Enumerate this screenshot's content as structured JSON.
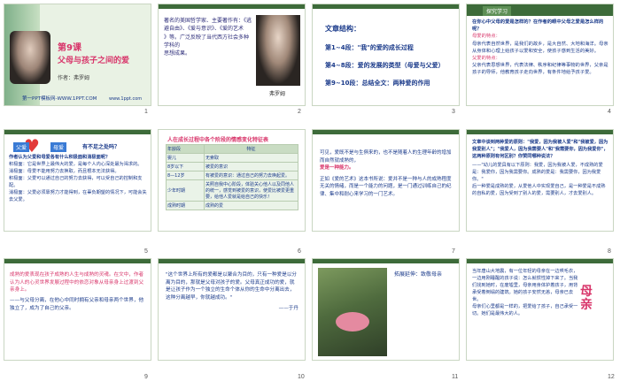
{
  "thumbnails": [
    {
      "num": "1",
      "title": "第9课",
      "subtitle": "父母与孩子之间的爱",
      "author": "作者：弗罗姆",
      "link": "第一PPT模板网-WWW.1PPT.COM",
      "url": "www.1ppt.com"
    },
    {
      "num": "2",
      "lines": [
        "著名的美国哲学家、主要著作有：《逃",
        "避自由》、《爱与意识》、《爱的艺术",
        "》等。广泛反映了当代西方社会多种学科的",
        "思想成果。"
      ],
      "caption": "弗罗姆"
    },
    {
      "num": "3",
      "heading": "文章结构：",
      "items": [
        "第1~4段：\"我\"的爱的成长过程",
        "第4~8段：爱的发展的类型（母爱与父爱）",
        "第9~10段：总结全文：两种爱的作用"
      ]
    },
    {
      "num": "4",
      "header": "探究学习",
      "lines": [
        "在你心中父母的爱是怎样的？在作者的眼中父母之爱是怎么样的呢？",
        "母爱的特点：",
        "母亲代表自然世界，是我们的故乡，是大自然、大地和海洋。母亲从身体和心理上给孩子以爱和安全，使孩子感到生活的美好。",
        "父爱的特点：",
        "父亲代表思想世界，代表法律、秩序和纪律等事物的世界，父亲是孩子的导师，他教育孩子走向世界，有条件地给予孩子爱。"
      ]
    },
    {
      "num": "5",
      "badges": [
        "父爱",
        "母爱"
      ],
      "question": "有不足之处吗？",
      "lines": [
        "作者认为父爱和母爱各有什么积极面和消极面呢？",
        "积极面：它是世界上最伟大的爱，是每个人内心深处最为渴求的。",
        "消极面：母爱不能用努力去换取，而且根本无法获得。",
        "积极面：父爱可以通过自己的努力去获得，可以受自己的控制和支配。",
        "消极面：父爱必须靠努力才能得到，在辜负期望的情况下，可能会失去父爱。"
      ]
    },
    {
      "num": "6",
      "title": "人在成长过程中各个阶段的情感变化特征表",
      "columns": [
        "年龄段",
        "特征"
      ],
      "rows": [
        [
          "婴儿",
          "无索取"
        ],
        [
          "8岁以下",
          "被爱的意识"
        ],
        [
          "8—12岁",
          "有被爱的意识：通过自己的努力去唤起爱。"
        ],
        [
          "少年时期",
          "关照自我中心阶段，体验关心他人以及同他人的统一，感觉到被爱的意识，使爱比被爱更重要，给他人爱就是给自己的快乐！"
        ],
        [
          "成熟时期",
          "成熟的爱"
        ]
      ]
    },
    {
      "num": "7",
      "lines": [
        "可见，爱既不是与生俱来的，也不是随着人的生理年龄的增加而自然就成熟的，",
        "爱是一种能力。",
        "正如《爱的艺术》这本书所说：爱并不是一种与人的成熟程度无关的情绪，而是一个能力的问题，是一门通过训练自己的纪律、集中和耐心来学习的一门艺术。"
      ]
    },
    {
      "num": "8",
      "lines": [
        "文章中谈到两种爱的原则：\"我爱，因为我被人爱\"和\"我被爱，因为我爱别人\"；\"我爱人，因为我需要人\"和\"我需要你，因为我爱你\"，这两种原则有何区别？你赞同哪种说法？",
        "——\"幼儿的爱具有以下原则：我爱，因为我被人爱，不成熟的爱是：我爱你，因为我需要你。成熟的爱是：我需要你，因为我爱你。\"",
        "后一种爱是成熟的爱，从爱他人中实现爱自己，是一种爱是不成熟的自私的爱，因为受到了别人的爱，需要别人，才去爱别人。"
      ]
    },
    {
      "num": "9",
      "lines": [
        "成熟的爱表现在孩子成熟的人生与成熟的灵魂。在文中，作者认为人的心灵世界发展过程中的依恋对象从母亲身上过渡到父亲身上。",
        "——与父母分离，在他心中同时拥有父亲和母亲两个世界，他独立了，成为了自己的父亲。"
      ]
    },
    {
      "num": "10",
      "lines": [
        "\"这个世界上所有的爱都是以聚合为目的，只有一种爱是以分离为目的，那就是父母对孩子的爱。父母真正成功的爱，就是让孩子作为一个独立的生命个体从你的生命中分离出去，这种分离越早，你就越成功。\"",
        "——于丹"
      ]
    },
    {
      "num": "11",
      "caption": "拓展延伸：致敬母亲"
    },
    {
      "num": "12",
      "lines": [
        "当年唐山大地震，有一位年轻的母亲在一边哄毛衣，一边用刚睡醒的孩子说：怎么就惯性掉下来了。当我们找到她时，在废墟里，母亲用身体护着孩子，用背承受着倒塌的建筑。她的孩子安然无恙，母亲已去世。",
        "母亲们心里都是一样的，把爱给了孩子，自己承受一切。她们是最伟大的人。"
      ],
      "decor": "母亲"
    }
  ],
  "colors": {
    "blue": "#1a3a8a",
    "pink": "#d8356a",
    "green": "#2b8c3a",
    "darkGreen": "#3d6b3a",
    "teal": "#2aa3a8"
  }
}
